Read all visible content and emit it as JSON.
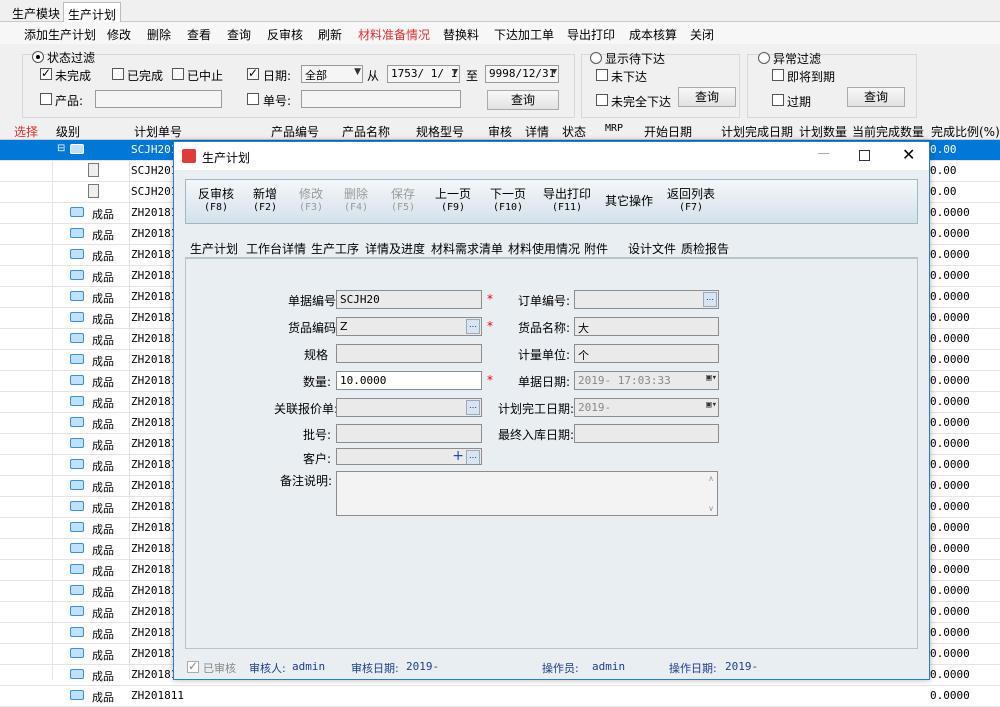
{
  "tabs": [
    "生产模块",
    "生产计划"
  ],
  "toolbar": [
    "添加生产计划",
    "修改",
    "删除",
    "查看",
    "查询",
    "反审核",
    "刷新",
    "材料准备情况",
    "替换料",
    "下达加工单",
    "导出打印",
    "成本核算",
    "关闭"
  ],
  "colors": {
    "highlight": "#e03030",
    "accent": "#0078d7",
    "dialog_border": "#2b79d0"
  },
  "filter": {
    "status_title": "状态过滤",
    "unfinished": "未完成",
    "finished": "已完成",
    "stopped": "已中止",
    "date_label": "日期:",
    "date_mode": "全部",
    "from_label": "从",
    "date_from": "1753/ 1/ 1",
    "to_label": "至",
    "date_to": "9998/12/31",
    "product_label": "产品:",
    "order_label": "单号:",
    "query": "查询",
    "pending_title": "显示待下达",
    "not_issued": "未下达",
    "partial_issued": "未完全下达",
    "abnormal_title": "异常过滤",
    "near_due": "即将到期",
    "overdue": "过期"
  },
  "grid": {
    "headers": [
      "选择",
      "级别",
      "计划单号",
      "产品编号",
      "产品名称",
      "规格型号",
      "审核",
      "详情",
      "状态",
      "MRP",
      "开始日期",
      "计划完成日期",
      "计划数量",
      "当前完成数量",
      "完成比例(%)"
    ],
    "rows": [
      {
        "level": "",
        "plan": "SCJH2019",
        "ratio": "0.00",
        "kind": "root"
      },
      {
        "level": "",
        "plan": "SCJH2019",
        "ratio": "0.00",
        "kind": "doc"
      },
      {
        "level": "",
        "plan": "SCJH2019",
        "ratio": "0.00",
        "kind": "doc"
      },
      {
        "level": "成品",
        "plan": "ZH201811",
        "ratio": "0.0000",
        "kind": "folder"
      },
      {
        "level": "成品",
        "plan": "ZH201811",
        "ratio": "0.0000",
        "kind": "folder"
      },
      {
        "level": "成品",
        "plan": "ZH201811",
        "ratio": "0.0000",
        "kind": "folder"
      },
      {
        "level": "成品",
        "plan": "ZH201811",
        "ratio": "0.0000",
        "kind": "folder"
      },
      {
        "level": "成品",
        "plan": "ZH201811",
        "ratio": "0.0000",
        "kind": "folder"
      },
      {
        "level": "成品",
        "plan": "ZH201811",
        "ratio": "0.0000",
        "kind": "folder"
      },
      {
        "level": "成品",
        "plan": "ZH201811",
        "ratio": "0.0000",
        "kind": "folder"
      },
      {
        "level": "成品",
        "plan": "ZH201811",
        "ratio": "0.0000",
        "kind": "folder"
      },
      {
        "level": "成品",
        "plan": "ZH201811",
        "ratio": "0.0000",
        "kind": "folder"
      },
      {
        "level": "成品",
        "plan": "ZH201811",
        "ratio": "0.0000",
        "kind": "folder"
      },
      {
        "level": "成品",
        "plan": "ZH201811",
        "ratio": "0.0000",
        "kind": "folder"
      },
      {
        "level": "成品",
        "plan": "ZH201811",
        "ratio": "0.0000",
        "kind": "folder"
      },
      {
        "level": "成品",
        "plan": "ZH201811",
        "ratio": "0.0000",
        "kind": "folder"
      },
      {
        "level": "成品",
        "plan": "ZH201811",
        "ratio": "0.0000",
        "kind": "folder"
      },
      {
        "level": "成品",
        "plan": "ZH201811",
        "ratio": "0.0000",
        "kind": "folder"
      },
      {
        "level": "成品",
        "plan": "ZH201811",
        "ratio": "0.0000",
        "kind": "folder"
      },
      {
        "level": "成品",
        "plan": "ZH201811",
        "ratio": "0.0000",
        "kind": "folder"
      },
      {
        "level": "成品",
        "plan": "ZH201811",
        "ratio": "0.0000",
        "kind": "folder"
      },
      {
        "level": "成品",
        "plan": "ZH201811",
        "ratio": "0.0000",
        "kind": "folder"
      },
      {
        "level": "成品",
        "plan": "ZH201811",
        "ratio": "0.0000",
        "kind": "folder"
      },
      {
        "level": "成品",
        "plan": "ZH201811",
        "ratio": "0.0000",
        "kind": "folder"
      },
      {
        "level": "成品",
        "plan": "ZH201811",
        "ratio": "0.0000",
        "kind": "folder"
      },
      {
        "level": "成品",
        "plan": "ZH201811",
        "ratio": "0.0000",
        "kind": "folder"
      },
      {
        "level": "成品",
        "plan": "ZH201811",
        "ratio": "0.0000",
        "kind": "folder"
      }
    ]
  },
  "dialog": {
    "title": "生产计划",
    "buttons": [
      {
        "label": "反审核",
        "key": "(F8)",
        "disabled": false
      },
      {
        "label": "新增",
        "key": "(F2)",
        "disabled": false
      },
      {
        "label": "修改",
        "key": "(F3)",
        "disabled": true
      },
      {
        "label": "删除",
        "key": "(F4)",
        "disabled": true
      },
      {
        "label": "保存",
        "key": "(F5)",
        "disabled": true
      },
      {
        "label": "上一页",
        "key": "(F9)",
        "disabled": false
      },
      {
        "label": "下一页",
        "key": "(F10)",
        "disabled": false
      },
      {
        "label": "导出打印",
        "key": "(F11)",
        "disabled": false
      },
      {
        "label": "其它操作",
        "key": "",
        "disabled": false
      },
      {
        "label": "返回列表",
        "key": "(F7)",
        "disabled": false
      }
    ],
    "tabs": [
      "生产计划",
      "工作台详情",
      "生产工序",
      "详情及进度",
      "材料需求清单",
      "材料使用情况",
      "附件",
      "设计文件",
      "质检报告"
    ],
    "form": {
      "doc_no_label": "单据编号:",
      "doc_no": "SCJH20",
      "order_no_label": "订单编号:",
      "order_no": "",
      "goods_code_label": "货品编码:",
      "goods_code": "Z",
      "goods_name_label": "货品名称:",
      "goods_name": "大",
      "spec_label": "规格",
      "spec": "",
      "unit_label": "计量单位:",
      "unit": "个",
      "qty_label": "数量:",
      "qty": "10.0000",
      "doc_date_label": "单据日期:",
      "doc_date": "2019-     17:03:33",
      "quote_label": "关联报价单:",
      "quote": "",
      "plan_done_label": "计划完工日期:",
      "plan_done": "2019-",
      "batch_label": "批号:",
      "batch": "",
      "final_in_label": "最终入库日期:",
      "final_in": "",
      "customer_label": "客户:",
      "customer": "",
      "remark_label": "备注说明:",
      "remark": ""
    },
    "status": {
      "audited": "已审核",
      "auditor_label": "审核人:",
      "auditor": "admin",
      "audit_date_label": "审核日期:",
      "audit_date": "2019-",
      "operator_label": "操作员:",
      "operator": "admin",
      "op_date_label": "操作日期:",
      "op_date": "2019-"
    }
  }
}
